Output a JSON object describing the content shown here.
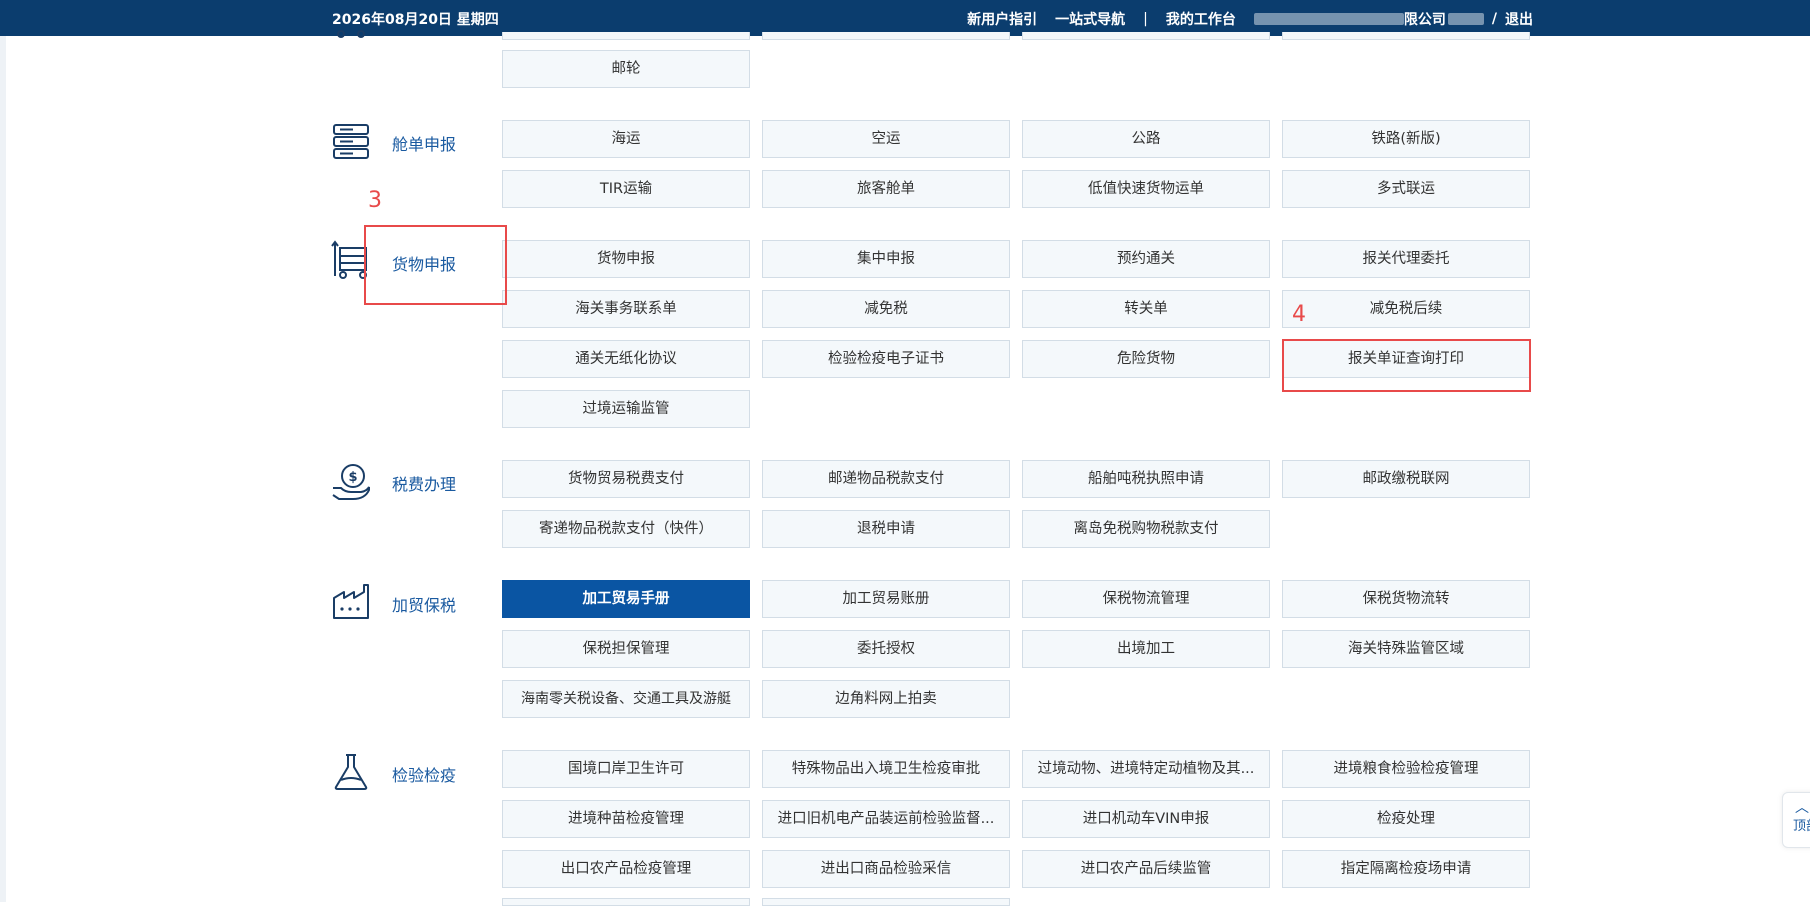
{
  "header": {
    "date": "2026年08月20日 星期四",
    "nav_links": [
      "新用户指引",
      "一站式导航"
    ],
    "separator": "|",
    "workbench": "我的工作台",
    "company_suffix": "限公司",
    "slash": "/",
    "logout": "退出"
  },
  "sections": {
    "top_partial": {
      "buttons": [
        "邮轮"
      ]
    },
    "manifest": {
      "label": "舱单申报",
      "buttons": [
        "海运",
        "空运",
        "公路",
        "铁路(新版)",
        "TIR运输",
        "旅客舱单",
        "低值快速货物运单",
        "多式联运"
      ]
    },
    "cargo": {
      "label": "货物申报",
      "buttons": [
        "货物申报",
        "集中申报",
        "预约通关",
        "报关代理委托",
        "海关事务联系单",
        "减免税",
        "转关单",
        "减免税后续",
        "通关无纸化协议",
        "检验检疫电子证书",
        "危险货物",
        "报关单证查询打印",
        "过境运输监管"
      ]
    },
    "tax": {
      "label": "税费办理",
      "buttons": [
        "货物贸易税费支付",
        "邮递物品税款支付",
        "船舶吨税执照申请",
        "邮政缴税联网",
        "寄递物品税款支付（快件）",
        "退税申请",
        "离岛免税购物税款支付"
      ]
    },
    "processing": {
      "label": "加贸保税",
      "buttons": [
        "加工贸易手册",
        "加工贸易账册",
        "保税物流管理",
        "保税货物流转",
        "保税担保管理",
        "委托授权",
        "出境加工",
        "海关特殊监管区域",
        "海南零关税设备、交通工具及游艇",
        "边角料网上拍卖"
      ]
    },
    "inspection": {
      "label": "检验检疫",
      "buttons": [
        "国境口岸卫生许可",
        "特殊物品出入境卫生检疫审批",
        "过境动物、进境特定动植物及其...",
        "进境粮食检验检疫管理",
        "进境种苗检疫管理",
        "进口旧机电产品装运前检验监督...",
        "进口机动车VIN申报",
        "检疫处理",
        "出口农产品检疫管理",
        "进出口商品检验采信",
        "进口农产品后续监管",
        "指定隔离检疫场申请"
      ]
    }
  },
  "annotations": {
    "step3": "3",
    "step4": "4"
  },
  "back_to_top": {
    "label": "顶部",
    "arrow": "︿"
  },
  "colors": {
    "header_bg": "#0b3d6e",
    "accent": "#0a55a3",
    "annotation": "#e84a4a"
  }
}
